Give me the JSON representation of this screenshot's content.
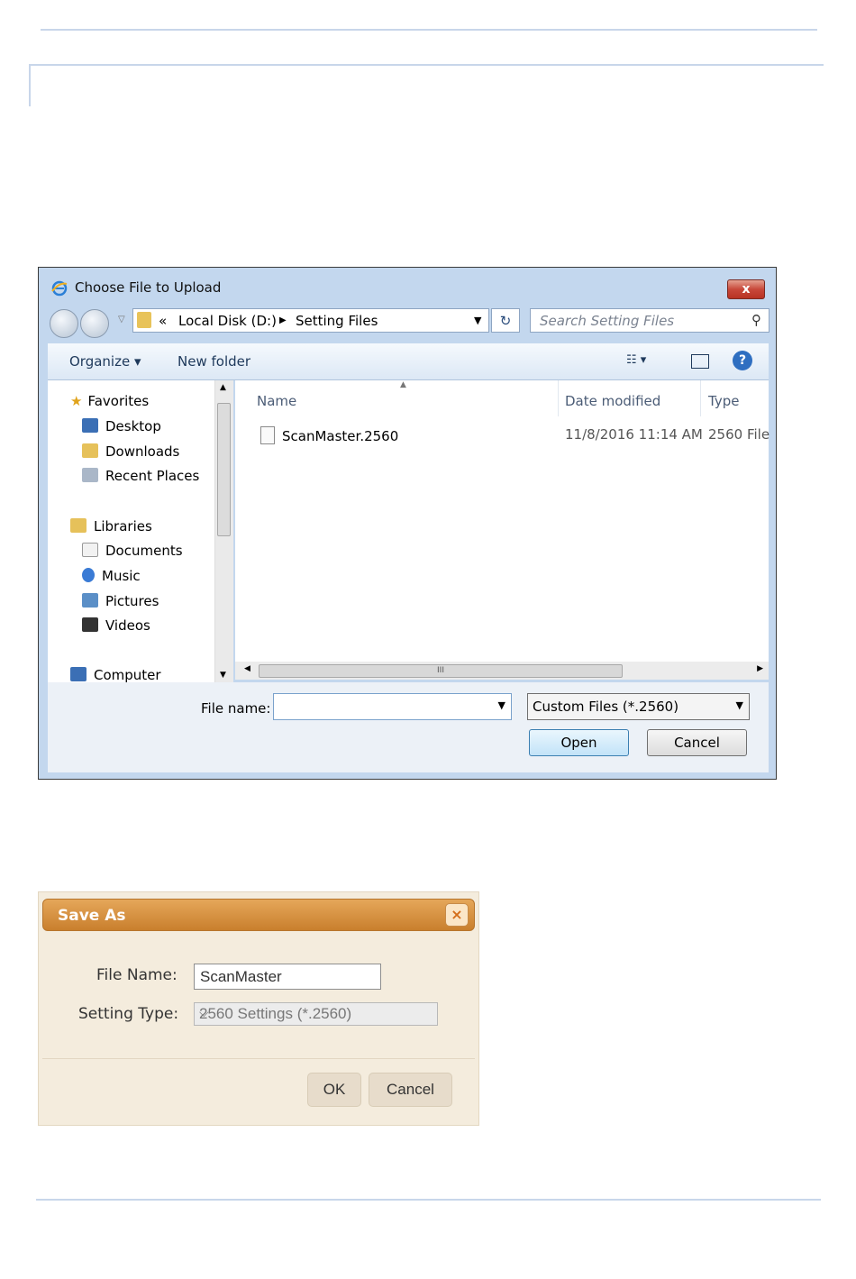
{
  "open_dialog": {
    "title": "Choose File to Upload",
    "close_label": "x",
    "address": {
      "chevrons": "«",
      "segments": [
        "Local Disk (D:)",
        "Setting Files"
      ]
    },
    "search_placeholder": "Search Setting Files",
    "toolbar": {
      "organize": "Organize",
      "new_folder": "New folder"
    },
    "navigation": {
      "favorites": {
        "label": "Favorites",
        "items": [
          "Desktop",
          "Downloads",
          "Recent Places"
        ]
      },
      "libraries": {
        "label": "Libraries",
        "items": [
          "Documents",
          "Music",
          "Pictures",
          "Videos"
        ]
      },
      "computer": "Computer"
    },
    "columns": [
      "Name",
      "Date modified",
      "Type"
    ],
    "files": [
      {
        "name": "ScanMaster.2560",
        "date_modified": "11/8/2016 11:14 AM",
        "type": "2560 File"
      }
    ],
    "file_name_label": "File name:",
    "file_name_value": "",
    "filter_value": "Custom Files (*.2560)",
    "open_label": "Open",
    "cancel_label": "Cancel"
  },
  "save_as_dialog": {
    "title": "Save As",
    "close_label": "×",
    "file_name_label": "File Name:",
    "file_name_value": "ScanMaster",
    "setting_type_label": "Setting Type:",
    "setting_type_value": "2560 Settings (*.2560)",
    "ok_label": "OK",
    "cancel_label": "Cancel"
  },
  "colors": {
    "save_as_title": "#d08a36",
    "win_frame": "#c3d7ee",
    "rule": "#c8d6ea"
  }
}
